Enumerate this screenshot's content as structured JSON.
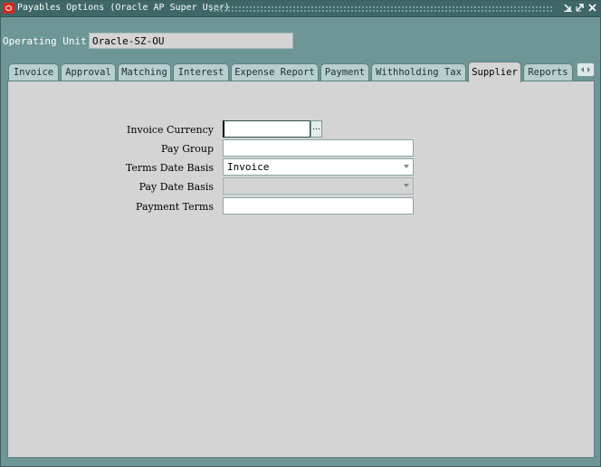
{
  "window": {
    "title": "Payables Options (Oracle AP Super User)"
  },
  "operating_unit": {
    "label": "Operating Unit",
    "value": "Oracle-SZ-OU"
  },
  "tabs": [
    {
      "label": "Invoice",
      "active": false
    },
    {
      "label": "Approval",
      "active": false
    },
    {
      "label": "Matching",
      "active": false
    },
    {
      "label": "Interest",
      "active": false
    },
    {
      "label": "Expense Report",
      "active": false
    },
    {
      "label": "Payment",
      "active": false
    },
    {
      "label": "Withholding Tax",
      "active": false
    },
    {
      "label": "Supplier",
      "active": true
    },
    {
      "label": "Reports",
      "active": false
    }
  ],
  "supplier_form": {
    "invoice_currency": {
      "label": "Invoice Currency",
      "value": "",
      "lov_button": "…"
    },
    "pay_group": {
      "label": "Pay Group",
      "value": ""
    },
    "terms_date_basis": {
      "label": "Terms Date Basis",
      "value": "Invoice"
    },
    "pay_date_basis": {
      "label": "Pay Date Basis",
      "value": ""
    },
    "payment_terms": {
      "label": "Payment Terms",
      "value": ""
    }
  },
  "colors": {
    "window_bg": "#6f9696",
    "titlebar": "#3f6767",
    "panel_bg": "#d4d4d4",
    "tab_inactive": "#b7cfcf"
  },
  "icons": {
    "app": "oracle-logo-icon",
    "minimize": "minimize-icon",
    "restore": "restore-icon",
    "close": "close-icon",
    "tab_scroll": "tab-scroll-arrows-icon",
    "lov": "ellipsis-icon",
    "dropdown": "dropdown-arrow-icon"
  }
}
